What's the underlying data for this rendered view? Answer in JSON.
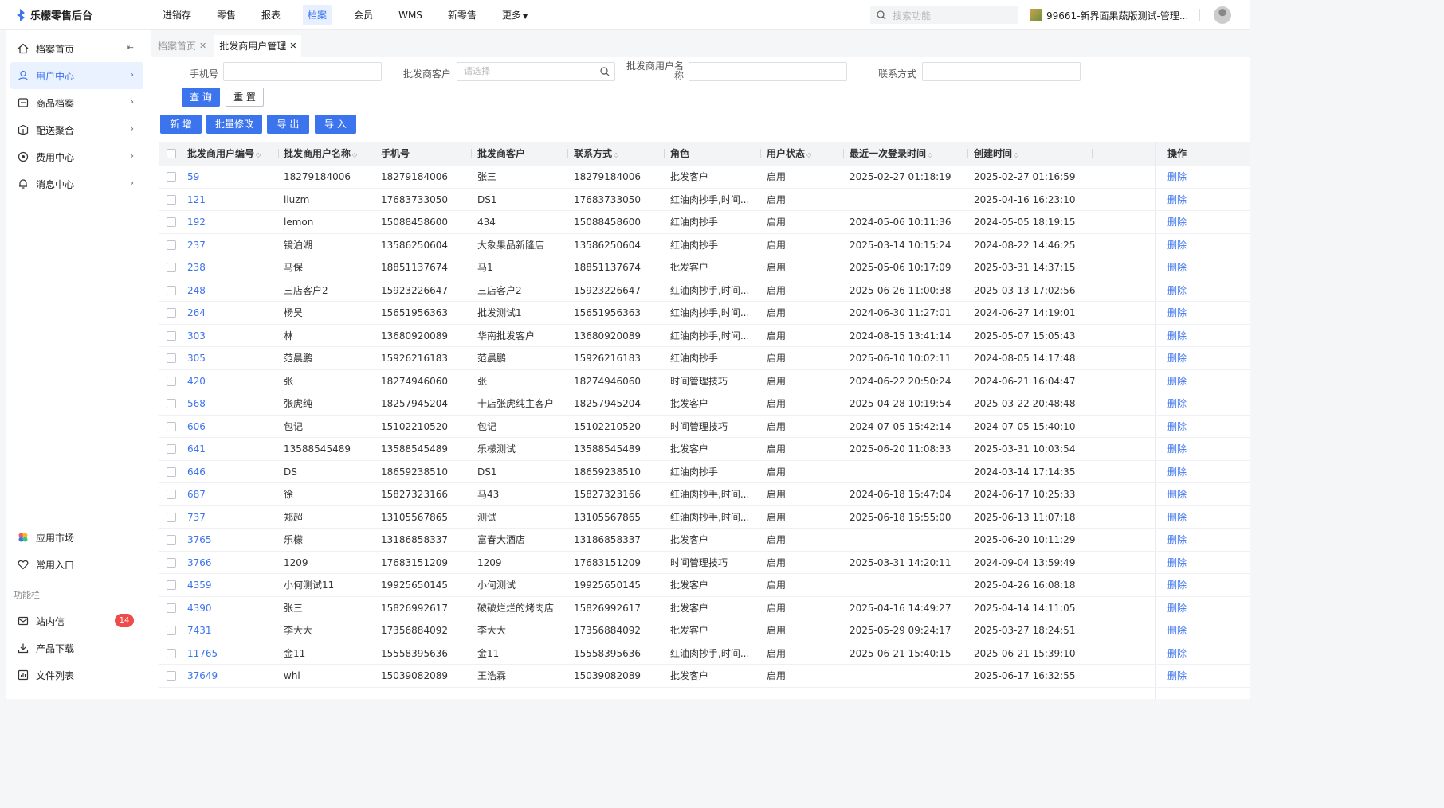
{
  "app": {
    "brand": "乐檬零售后台",
    "nav": [
      {
        "label": "进销存",
        "active": false
      },
      {
        "label": "零售",
        "active": false
      },
      {
        "label": "报表",
        "active": false
      },
      {
        "label": "档案",
        "active": true
      },
      {
        "label": "会员",
        "active": false
      },
      {
        "label": "WMS",
        "active": false
      },
      {
        "label": "新零售",
        "active": false
      },
      {
        "label": "更多",
        "active": false
      }
    ],
    "search_placeholder": "搜索功能",
    "store_name": "99661-新界面果蔬版测试-管理..."
  },
  "sidebar": {
    "items": [
      {
        "label": "档案首页",
        "icon": "home-icon",
        "active": false
      },
      {
        "label": "用户中心",
        "icon": "user-icon",
        "active": true
      },
      {
        "label": "商品档案",
        "icon": "box-icon",
        "active": false
      },
      {
        "label": "配送聚合",
        "icon": "delivery-icon",
        "active": false
      },
      {
        "label": "费用中心",
        "icon": "fee-icon",
        "active": false
      },
      {
        "label": "消息中心",
        "icon": "bell-icon",
        "active": false
      }
    ],
    "bottom": [
      {
        "label": "应用市场",
        "icon": "app-market-icon"
      },
      {
        "label": "常用入口",
        "icon": "heart-icon"
      }
    ],
    "section_label": "功能栏",
    "tools": [
      {
        "label": "站内信",
        "icon": "mail-icon",
        "badge": "14"
      },
      {
        "label": "产品下载",
        "icon": "download-icon"
      },
      {
        "label": "文件列表",
        "icon": "file-list-icon"
      }
    ]
  },
  "tabs": [
    {
      "label": "档案首页",
      "active": false
    },
    {
      "label": "批发商用户管理",
      "active": true
    }
  ],
  "filters": {
    "phone_label": "手机号",
    "customer_label": "批发商客户",
    "customer_placeholder": "请选择",
    "name_label_line1": "批发商用户名",
    "name_label_line2": "称",
    "contact_label": "联系方式",
    "query_button": "查 询",
    "reset_button": "重 置"
  },
  "actions": {
    "add": "新 增",
    "batch_edit": "批量修改",
    "export": "导 出",
    "import": "导 入"
  },
  "table": {
    "columns": [
      "批发商用户编号",
      "批发商用户名称",
      "手机号",
      "批发商客户",
      "联系方式",
      "角色",
      "用户状态",
      "最近一次登录时间",
      "创建时间",
      "操作"
    ],
    "delete_label": "删除",
    "rows": [
      [
        "59",
        "18279184006",
        "18279184006",
        "张三",
        "18279184006",
        "批发客户",
        "启用",
        "2025-02-27 01:18:19",
        "2025-02-27 01:16:59"
      ],
      [
        "121",
        "liuzm",
        "17683733050",
        "DS1",
        "17683733050",
        "红油肉抄手,时间...",
        "启用",
        "",
        "2025-04-16 16:23:10"
      ],
      [
        "192",
        "lemon",
        "15088458600",
        "434",
        "15088458600",
        "红油肉抄手",
        "启用",
        "2024-05-06 10:11:36",
        "2024-05-05 18:19:15"
      ],
      [
        "237",
        "镜泊湖",
        "13586250604",
        "大象果品新隆店",
        "13586250604",
        "红油肉抄手",
        "启用",
        "2025-03-14 10:15:24",
        "2024-08-22 14:46:25"
      ],
      [
        "238",
        "马保",
        "18851137674",
        "马1",
        "18851137674",
        "批发客户",
        "启用",
        "2025-05-06 10:17:09",
        "2025-03-31 14:37:15"
      ],
      [
        "248",
        "三店客户2",
        "15923226647",
        "三店客户2",
        "15923226647",
        "红油肉抄手,时间...",
        "启用",
        "2025-06-26 11:00:38",
        "2025-03-13 17:02:56"
      ],
      [
        "264",
        "杨昊",
        "15651956363",
        "批发测试1",
        "15651956363",
        "红油肉抄手,时间...",
        "启用",
        "2024-06-30 11:27:01",
        "2024-06-27 14:19:01"
      ],
      [
        "303",
        "林",
        "13680920089",
        "华南批发客户",
        "13680920089",
        "红油肉抄手,时间...",
        "启用",
        "2024-08-15 13:41:14",
        "2025-05-07 15:05:43"
      ],
      [
        "305",
        "范晨鹏",
        "15926216183",
        "范晨鹏",
        "15926216183",
        "红油肉抄手",
        "启用",
        "2025-06-10 10:02:11",
        "2024-08-05 14:17:48"
      ],
      [
        "420",
        "张",
        "18274946060",
        "张",
        "18274946060",
        "时间管理技巧",
        "启用",
        "2024-06-22 20:50:24",
        "2024-06-21 16:04:47"
      ],
      [
        "568",
        "张虎纯",
        "18257945204",
        "十店张虎纯主客户",
        "18257945204",
        "批发客户",
        "启用",
        "2025-04-28 10:19:54",
        "2025-03-22 20:48:48"
      ],
      [
        "606",
        "包记",
        "15102210520",
        "包记",
        "15102210520",
        "时间管理技巧",
        "启用",
        "2024-07-05 15:42:14",
        "2024-07-05 15:40:10"
      ],
      [
        "641",
        "13588545489",
        "13588545489",
        "乐檬测试",
        "13588545489",
        "批发客户",
        "启用",
        "2025-06-20 11:08:33",
        "2025-03-31 10:03:54"
      ],
      [
        "646",
        "DS",
        "18659238510",
        "DS1",
        "18659238510",
        "红油肉抄手",
        "启用",
        "",
        "2024-03-14 17:14:35"
      ],
      [
        "687",
        "徐",
        "15827323166",
        "马43",
        "15827323166",
        "红油肉抄手,时间...",
        "启用",
        "2024-06-18 15:47:04",
        "2024-06-17 10:25:33"
      ],
      [
        "737",
        "郑超",
        "13105567865",
        "测试",
        "13105567865",
        "红油肉抄手,时间...",
        "启用",
        "2025-06-18 15:55:00",
        "2025-06-13 11:07:18"
      ],
      [
        "3765",
        "乐檬",
        "13186858337",
        "富春大酒店",
        "13186858337",
        "批发客户",
        "启用",
        "",
        "2025-06-20 10:11:29"
      ],
      [
        "3766",
        "1209",
        "17683151209",
        "1209",
        "17683151209",
        "时间管理技巧",
        "启用",
        "2025-03-31 14:20:11",
        "2024-09-04 13:59:49"
      ],
      [
        "4359",
        "小何测试11",
        "19925650145",
        "小何测试",
        "19925650145",
        "批发客户",
        "启用",
        "",
        "2025-04-26 16:08:18"
      ],
      [
        "4390",
        "张三",
        "15826992617",
        "破破烂烂的烤肉店",
        "15826992617",
        "批发客户",
        "启用",
        "2025-04-16 14:49:27",
        "2025-04-14 14:11:05"
      ],
      [
        "7431",
        "李大大",
        "17356884092",
        "李大大",
        "17356884092",
        "批发客户",
        "启用",
        "2025-05-29 09:24:17",
        "2025-03-27 18:24:51"
      ],
      [
        "11765",
        "金11",
        "15558395636",
        "金11",
        "15558395636",
        "红油肉抄手,时间...",
        "启用",
        "2025-06-21 15:40:15",
        "2025-06-21 15:39:10"
      ],
      [
        "37649",
        "whl",
        "15039082089",
        "王浩霖",
        "15039082089",
        "批发客户",
        "启用",
        "",
        "2025-06-17 16:32:55"
      ]
    ]
  },
  "colors": {
    "accent": "#3c74ee",
    "badge": "#f04b4b"
  }
}
